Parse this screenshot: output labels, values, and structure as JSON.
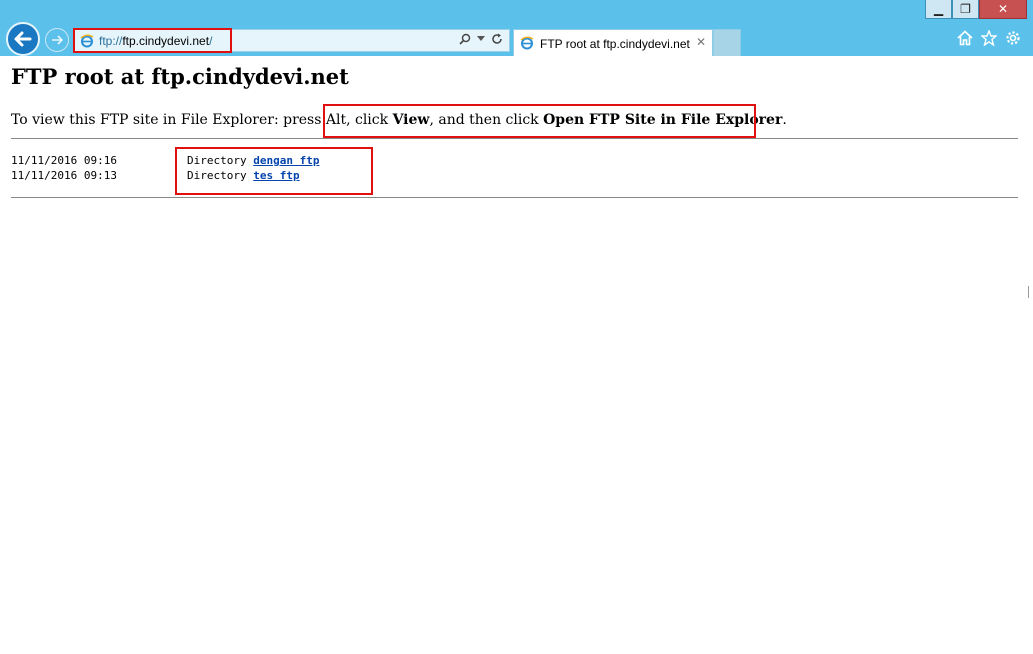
{
  "browser": {
    "address": {
      "scheme": "ftp://",
      "host": "ftp.cindydevi.net",
      "suffix": "/"
    },
    "tab_title": "FTP root at ftp.cindydevi.net",
    "window_buttons": {
      "minimize": "▁",
      "restore": "❐",
      "close": "✕"
    },
    "icons": [
      "back-arrow-icon",
      "forward-arrow-icon",
      "ie-logo-icon",
      "search-icon",
      "dropdown-icon",
      "refresh-icon",
      "close-tab-icon",
      "home-icon",
      "favorites-star-icon",
      "settings-gear-icon"
    ]
  },
  "page": {
    "title": "FTP root at ftp.cindydevi.net",
    "info": {
      "prefix": "To view this FTP site in File Explorer: press Alt, click ",
      "view": "View",
      "middle": ", and then click ",
      "open": "Open FTP Site in File Explorer",
      "end": "."
    },
    "entries": [
      {
        "date": "11/11/2016 09:16",
        "type": "Directory",
        "name": "dengan ftp"
      },
      {
        "date": "11/11/2016 09:13",
        "type": "Directory",
        "name": "tes ftp"
      }
    ]
  }
}
